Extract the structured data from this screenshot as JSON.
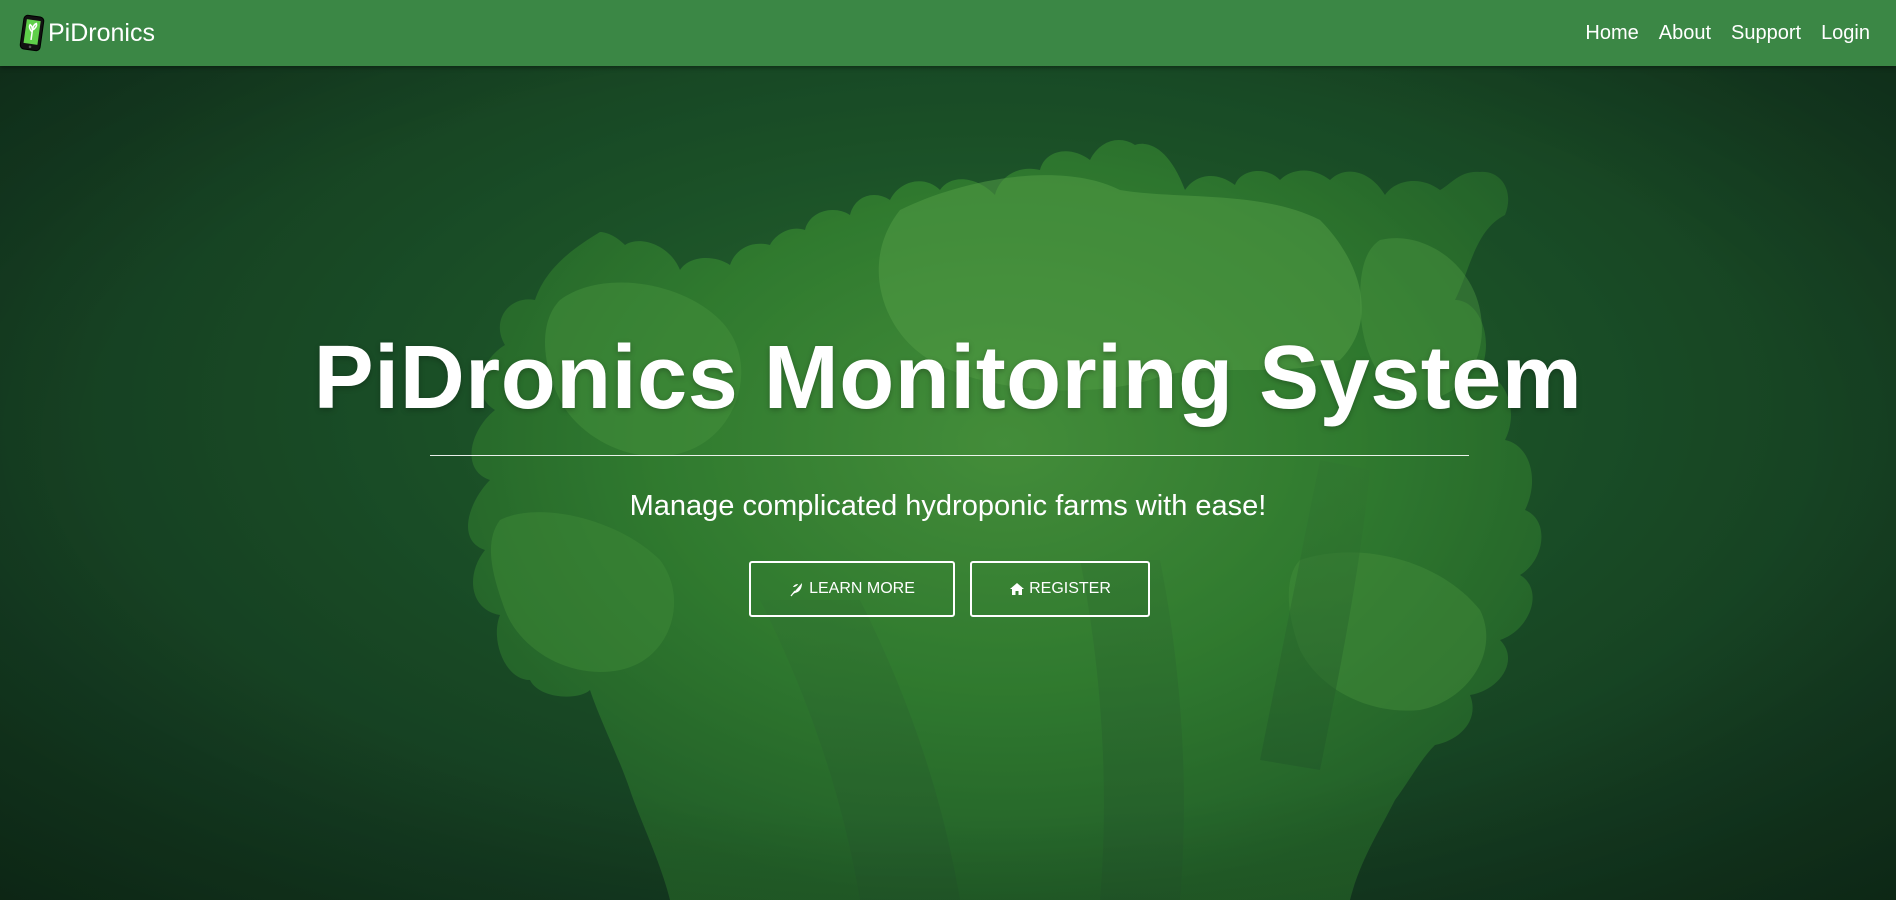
{
  "navbar": {
    "brand": "PiDronics",
    "links": [
      {
        "label": "Home"
      },
      {
        "label": "About"
      },
      {
        "label": "Support"
      },
      {
        "label": "Login"
      }
    ]
  },
  "hero": {
    "title": "PiDronics Monitoring System",
    "subtitle": "Manage complicated hydroponic farms with ease!",
    "buttons": {
      "learn_more": {
        "label": "LEARN MORE",
        "icon": "leaf-icon"
      },
      "register": {
        "label": "REGISTER",
        "icon": "home-icon"
      }
    },
    "background": "lettuce-image"
  },
  "colors": {
    "navbar": "#3b8745",
    "background": "#1f5a2c",
    "text": "#ffffff"
  }
}
